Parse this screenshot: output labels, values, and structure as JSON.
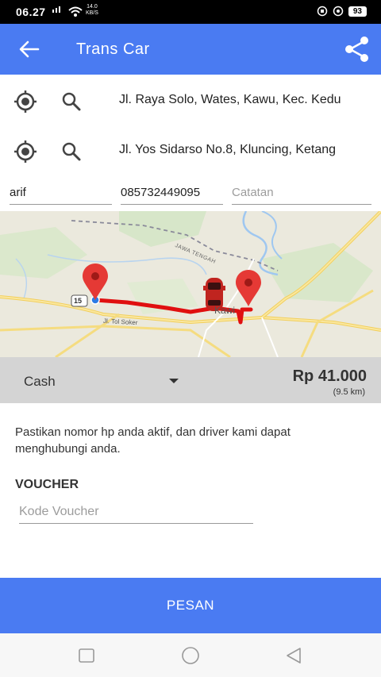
{
  "status_bar": {
    "time": "06.27",
    "net_speed_value": "14.0",
    "net_speed_unit": "KB/S",
    "battery": "93"
  },
  "app_bar": {
    "title": "Trans Car",
    "back_icon": "arrow-left-icon",
    "share_icon": "share-icon"
  },
  "route": {
    "origin": "Jl. Raya Solo, Wates, Kawu, Kec. Kedu",
    "destination": "Jl. Yos Sidarso No.8, Kluncing, Ketang"
  },
  "form": {
    "name_value": "arif",
    "phone_value": "085732449095",
    "note_placeholder": "Catatan"
  },
  "map": {
    "road_label_1": "JAWA TENGAH",
    "road_label_2": "Jl. Tol Soker",
    "route_shield": "15",
    "town_label": "Kawi"
  },
  "payment": {
    "method": "Cash",
    "price": "Rp 41.000",
    "distance": "(9.5 km)"
  },
  "notice": "Pastikan nomor hp anda aktif, dan driver kami dapat menghubungi anda.",
  "voucher": {
    "label": "VOUCHER",
    "placeholder": "Kode Voucher"
  },
  "order_button": "PESAN",
  "colors": {
    "primary": "#4a7bf2",
    "route": "#e01010",
    "pin": "#e53935"
  }
}
